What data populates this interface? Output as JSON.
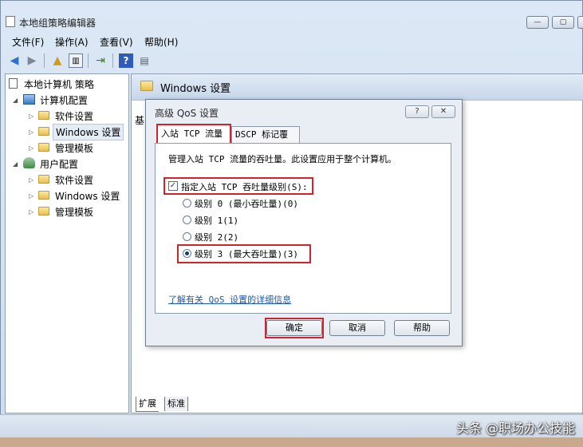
{
  "window": {
    "title": "本地组策略编辑器"
  },
  "menu": [
    "文件(F)",
    "操作(A)",
    "查看(V)",
    "帮助(H)"
  ],
  "toolbar_icons": [
    "back-icon",
    "forward-icon",
    "up-folder-icon",
    "show-hide-tree-icon",
    "export-icon",
    "help-icon",
    "properties-icon"
  ],
  "tree": {
    "root": "本地计算机 策略",
    "computer_config": "计算机配置",
    "cc_software": "软件设置",
    "cc_windows": "Windows 设置",
    "cc_templates": "管理模板",
    "user_config": "用户配置",
    "uc_software": "软件设置",
    "uc_windows": "Windows 设置",
    "uc_templates": "管理模板"
  },
  "right_pane": {
    "header": "Windows 设置",
    "partial_label": "基"
  },
  "dialog": {
    "title": "高级 QoS 设置",
    "help_glyph": "?",
    "close_glyph": "✕",
    "tabs": [
      "入站 TCP 流量",
      "DSCP 标记覆盖"
    ],
    "description": "管理入站 TCP 流量的吞吐量。此设置应用于整个计算机。",
    "checkbox_label": "指定入站 TCP 吞吐量级别(S):",
    "checkbox_checked": true,
    "levels": [
      {
        "label": "级别 0 (最小吞吐量)(0)",
        "selected": false
      },
      {
        "label": "级别 1(1)",
        "selected": false
      },
      {
        "label": "级别 2(2)",
        "selected": false
      },
      {
        "label": "级别 3 (最大吞吐量)(3)",
        "selected": true
      }
    ],
    "link": "了解有关 QoS 设置的详细信息",
    "buttons": {
      "ok": "确定",
      "cancel": "取消",
      "help": "帮助"
    }
  },
  "bottom_tabs": [
    "扩展",
    "标准"
  ],
  "watermark": "头条 @职场办公技能",
  "colors": {
    "highlight_red": "#d0242c",
    "link_blue": "#1f5aa8"
  }
}
